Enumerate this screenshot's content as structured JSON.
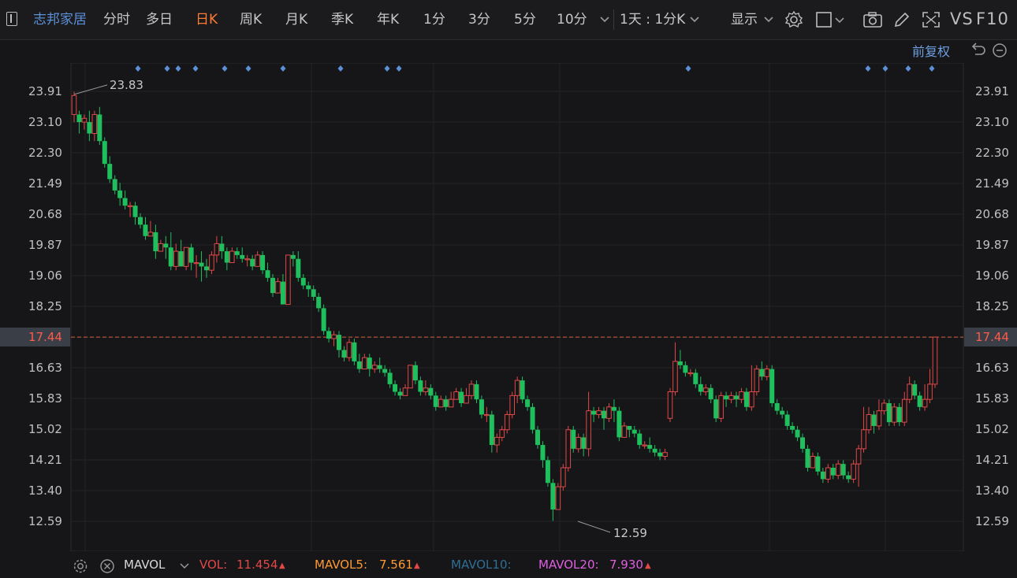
{
  "toolbar": {
    "stock_name": "志邦家居",
    "periods": [
      {
        "label": "分时",
        "active": false
      },
      {
        "label": "多日",
        "active": false
      },
      {
        "label": "日K",
        "active": true
      },
      {
        "label": "周K",
        "active": false
      },
      {
        "label": "月K",
        "active": false
      },
      {
        "label": "季K",
        "active": false
      },
      {
        "label": "年K",
        "active": false
      },
      {
        "label": "1分",
        "active": false
      },
      {
        "label": "3分",
        "active": false
      },
      {
        "label": "5分",
        "active": false
      },
      {
        "label": "10分",
        "active": false
      }
    ],
    "range_label": "1天 : 1分K",
    "display_label": "显示",
    "vs_label": "VS",
    "f10_label": "F10",
    "adjust_label": "前复权"
  },
  "chart_data": {
    "type": "candlestick",
    "y_ticks": [
      "23.91",
      "23.10",
      "22.30",
      "21.49",
      "20.68",
      "19.87",
      "19.06",
      "18.25",
      "17.44",
      "16.63",
      "15.83",
      "15.02",
      "14.21",
      "13.40",
      "12.59"
    ],
    "ylim": [
      12.59,
      23.91
    ],
    "current_price": "17.44",
    "high_label": "23.83",
    "low_label": "12.59",
    "candles": [
      [
        23.3,
        23.8,
        23.9,
        23.1
      ],
      [
        23.3,
        23.1,
        23.4,
        22.8
      ],
      [
        23.1,
        23.2,
        23.3,
        22.9
      ],
      [
        23.1,
        22.8,
        23.4,
        22.6
      ],
      [
        22.8,
        23.3,
        23.4,
        22.6
      ],
      [
        23.3,
        22.6,
        23.5,
        22.5
      ],
      [
        22.6,
        22.0,
        22.7,
        21.9
      ],
      [
        22.0,
        21.6,
        22.2,
        21.5
      ],
      [
        21.6,
        21.3,
        21.7,
        21.2
      ],
      [
        21.3,
        21.1,
        21.5,
        20.9
      ],
      [
        21.1,
        20.9,
        21.3,
        20.8
      ],
      [
        20.9,
        20.9,
        21.0,
        20.6
      ],
      [
        20.9,
        20.6,
        21.0,
        20.4
      ],
      [
        20.6,
        20.4,
        20.7,
        20.3
      ],
      [
        20.4,
        20.1,
        20.6,
        20.0
      ],
      [
        20.1,
        20.2,
        20.5,
        20.1
      ],
      [
        20.2,
        19.7,
        20.4,
        19.5
      ],
      [
        19.7,
        19.9,
        20.0,
        19.7
      ],
      [
        19.9,
        19.8,
        20.1,
        19.5
      ],
      [
        19.8,
        19.3,
        20.2,
        19.2
      ],
      [
        19.3,
        19.7,
        19.9,
        19.2
      ],
      [
        19.7,
        19.3,
        20.0,
        19.3
      ],
      [
        19.3,
        19.8,
        19.8,
        19.2
      ],
      [
        19.8,
        19.4,
        19.9,
        19.2
      ],
      [
        19.4,
        19.4,
        19.6,
        19.0
      ],
      [
        19.4,
        19.3,
        19.7,
        18.9
      ],
      [
        19.3,
        19.2,
        19.5,
        19.0
      ],
      [
        19.2,
        19.6,
        19.7,
        19.1
      ],
      [
        19.6,
        19.9,
        20.1,
        19.4
      ],
      [
        19.9,
        19.7,
        20.1,
        19.5
      ],
      [
        19.7,
        19.4,
        19.8,
        19.2
      ],
      [
        19.4,
        19.7,
        19.8,
        19.4
      ],
      [
        19.7,
        19.6,
        19.8,
        19.5
      ],
      [
        19.6,
        19.5,
        19.8,
        19.4
      ],
      [
        19.5,
        19.5,
        19.6,
        19.3
      ],
      [
        19.5,
        19.3,
        19.6,
        19.2
      ],
      [
        19.3,
        19.6,
        19.7,
        19.3
      ],
      [
        19.6,
        19.2,
        19.7,
        19.1
      ],
      [
        19.2,
        19.0,
        19.4,
        18.9
      ],
      [
        19.0,
        18.6,
        19.1,
        18.5
      ],
      [
        18.6,
        18.9,
        19.0,
        18.6
      ],
      [
        18.9,
        18.3,
        19.1,
        18.3
      ],
      [
        18.3,
        19.6,
        19.6,
        18.3
      ],
      [
        19.6,
        19.5,
        19.7,
        19.3
      ],
      [
        19.5,
        19.0,
        19.7,
        18.9
      ],
      [
        19.0,
        18.8,
        19.1,
        18.7
      ],
      [
        18.8,
        18.7,
        18.9,
        18.5
      ],
      [
        18.7,
        18.5,
        18.8,
        18.4
      ],
      [
        18.5,
        18.2,
        18.6,
        18.1
      ],
      [
        18.2,
        17.6,
        18.3,
        17.5
      ],
      [
        17.6,
        17.4,
        17.7,
        17.3
      ],
      [
        17.4,
        17.5,
        17.6,
        17.2
      ],
      [
        17.5,
        17.1,
        17.6,
        16.9
      ],
      [
        17.1,
        16.9,
        17.2,
        16.8
      ],
      [
        16.9,
        17.3,
        17.4,
        16.8
      ],
      [
        17.3,
        16.8,
        17.4,
        16.7
      ],
      [
        16.8,
        16.6,
        17.0,
        16.5
      ],
      [
        16.6,
        16.9,
        17.0,
        16.6
      ],
      [
        16.9,
        16.6,
        17.0,
        16.4
      ],
      [
        16.6,
        16.7,
        16.8,
        16.5
      ],
      [
        16.7,
        16.6,
        16.9,
        16.5
      ],
      [
        16.6,
        16.5,
        16.7,
        16.4
      ],
      [
        16.5,
        16.2,
        16.6,
        16.1
      ],
      [
        16.2,
        16.0,
        16.3,
        15.9
      ],
      [
        16.0,
        15.9,
        16.1,
        15.8
      ],
      [
        15.9,
        16.1,
        16.2,
        15.9
      ],
      [
        16.1,
        16.7,
        16.7,
        16.1
      ],
      [
        16.7,
        16.3,
        16.8,
        16.2
      ],
      [
        16.3,
        16.0,
        16.4,
        15.9
      ],
      [
        16.0,
        16.1,
        16.3,
        15.9
      ],
      [
        16.1,
        15.9,
        16.2,
        15.8
      ],
      [
        15.9,
        15.6,
        16.0,
        15.5
      ],
      [
        15.6,
        15.8,
        15.9,
        15.6
      ],
      [
        15.8,
        15.6,
        15.9,
        15.5
      ],
      [
        15.6,
        15.8,
        16.0,
        15.6
      ],
      [
        15.8,
        16.0,
        16.1,
        15.8
      ],
      [
        16.0,
        15.7,
        16.1,
        15.6
      ],
      [
        15.7,
        15.9,
        16.1,
        15.7
      ],
      [
        15.9,
        16.2,
        16.3,
        15.8
      ],
      [
        16.2,
        15.8,
        16.3,
        15.7
      ],
      [
        15.8,
        15.4,
        15.9,
        15.3
      ],
      [
        15.4,
        15.4,
        15.6,
        15.2
      ],
      [
        15.4,
        14.6,
        15.5,
        14.4
      ],
      [
        14.6,
        14.8,
        14.9,
        14.4
      ],
      [
        14.8,
        15.0,
        15.1,
        14.7
      ],
      [
        15.0,
        15.4,
        15.5,
        14.9
      ],
      [
        15.4,
        15.9,
        16.0,
        15.3
      ],
      [
        15.9,
        16.3,
        16.4,
        15.7
      ],
      [
        16.3,
        15.8,
        16.4,
        15.7
      ],
      [
        15.8,
        15.6,
        15.9,
        15.5
      ],
      [
        15.6,
        15.0,
        15.7,
        14.9
      ],
      [
        15.0,
        14.6,
        15.1,
        14.5
      ],
      [
        14.6,
        14.2,
        14.7,
        14.0
      ],
      [
        14.2,
        13.6,
        14.3,
        13.5
      ],
      [
        13.6,
        12.9,
        13.7,
        12.6
      ],
      [
        12.9,
        13.5,
        13.6,
        12.9
      ],
      [
        13.5,
        14.0,
        14.1,
        13.4
      ],
      [
        14.0,
        15.0,
        15.1,
        13.9
      ],
      [
        15.0,
        14.5,
        15.1,
        14.4
      ],
      [
        14.5,
        14.8,
        14.9,
        14.4
      ],
      [
        14.8,
        14.5,
        14.9,
        14.3
      ],
      [
        14.5,
        15.5,
        16.0,
        14.3
      ],
      [
        15.5,
        15.4,
        15.6,
        15.2
      ],
      [
        15.4,
        15.5,
        15.6,
        15.3
      ],
      [
        15.5,
        15.3,
        15.6,
        15.0
      ],
      [
        15.3,
        15.6,
        15.7,
        15.2
      ],
      [
        15.6,
        15.5,
        15.8,
        15.2
      ],
      [
        15.5,
        14.8,
        15.6,
        14.7
      ],
      [
        14.8,
        15.1,
        15.2,
        14.8
      ],
      [
        15.1,
        15.0,
        15.1,
        14.8
      ],
      [
        15.0,
        14.9,
        15.1,
        14.8
      ],
      [
        14.9,
        14.6,
        15.0,
        14.5
      ],
      [
        14.6,
        14.6,
        14.7,
        14.5
      ],
      [
        14.6,
        14.5,
        14.8,
        14.4
      ],
      [
        14.5,
        14.4,
        14.6,
        14.3
      ],
      [
        14.4,
        14.3,
        14.5,
        14.2
      ],
      [
        14.3,
        14.4,
        14.5,
        14.2
      ],
      [
        15.3,
        16.0,
        16.1,
        15.2
      ],
      [
        16.0,
        16.8,
        17.3,
        15.9
      ],
      [
        16.8,
        16.7,
        17.1,
        16.6
      ],
      [
        16.7,
        16.5,
        16.8,
        16.4
      ],
      [
        16.5,
        16.5,
        16.6,
        16.4
      ],
      [
        16.5,
        16.2,
        16.6,
        16.1
      ],
      [
        16.2,
        16.0,
        16.4,
        15.9
      ],
      [
        16.0,
        16.1,
        16.2,
        15.9
      ],
      [
        16.1,
        15.8,
        16.2,
        15.7
      ],
      [
        15.8,
        15.3,
        15.9,
        15.2
      ],
      [
        15.3,
        15.9,
        16.0,
        15.2
      ],
      [
        15.9,
        15.8,
        16.0,
        15.6
      ],
      [
        15.8,
        15.9,
        16.0,
        15.7
      ],
      [
        15.9,
        15.8,
        16.0,
        15.6
      ],
      [
        15.8,
        16.0,
        16.1,
        15.7
      ],
      [
        16.0,
        15.6,
        16.1,
        15.5
      ],
      [
        15.6,
        16.0,
        16.7,
        15.5
      ],
      [
        16.0,
        16.6,
        16.7,
        15.9
      ],
      [
        16.6,
        16.4,
        16.8,
        16.3
      ],
      [
        16.4,
        16.6,
        16.7,
        16.3
      ],
      [
        16.6,
        15.7,
        16.7,
        15.6
      ],
      [
        15.7,
        15.5,
        15.8,
        15.4
      ],
      [
        15.5,
        15.4,
        15.6,
        15.3
      ],
      [
        15.4,
        15.1,
        15.5,
        15.0
      ],
      [
        15.1,
        15.0,
        15.2,
        14.9
      ],
      [
        15.0,
        14.8,
        15.1,
        14.7
      ],
      [
        14.8,
        14.5,
        14.9,
        14.4
      ],
      [
        14.5,
        14.0,
        14.6,
        13.9
      ],
      [
        14.0,
        14.3,
        14.4,
        14.0
      ],
      [
        14.3,
        13.9,
        14.4,
        13.8
      ],
      [
        13.9,
        13.7,
        14.0,
        13.6
      ],
      [
        13.7,
        14.0,
        14.1,
        13.6
      ],
      [
        14.0,
        13.8,
        14.1,
        13.7
      ],
      [
        13.8,
        14.1,
        14.2,
        13.7
      ],
      [
        14.1,
        13.8,
        14.2,
        13.7
      ],
      [
        13.8,
        13.7,
        13.9,
        13.6
      ],
      [
        13.7,
        14.1,
        14.2,
        13.6
      ],
      [
        14.1,
        14.5,
        14.6,
        13.5
      ],
      [
        14.5,
        15.0,
        15.6,
        14.4
      ],
      [
        15.0,
        15.4,
        15.6,
        14.9
      ],
      [
        15.4,
        15.1,
        15.5,
        14.9
      ],
      [
        15.1,
        15.5,
        15.8,
        15.0
      ],
      [
        15.5,
        15.7,
        15.8,
        15.4
      ],
      [
        15.7,
        15.2,
        15.8,
        15.1
      ],
      [
        15.2,
        15.6,
        15.7,
        15.1
      ],
      [
        15.6,
        15.2,
        15.7,
        15.1
      ],
      [
        15.2,
        15.8,
        16.0,
        15.1
      ],
      [
        15.8,
        16.2,
        16.4,
        15.7
      ],
      [
        16.2,
        15.9,
        16.3,
        15.8
      ],
      [
        15.9,
        15.6,
        16.0,
        15.5
      ],
      [
        15.6,
        15.8,
        16.2,
        15.5
      ],
      [
        15.8,
        16.2,
        16.6,
        15.7
      ],
      [
        16.2,
        17.44,
        17.44,
        16.1
      ]
    ],
    "markers_count": 15
  },
  "volume": {
    "indicator_label": "MAVOL",
    "vol_label": "VOL:",
    "vol_value": "11.454",
    "mavol5_label": "MAVOL5:",
    "mavol5_value": "7.561",
    "mavol10_label": "MAVOL10:",
    "mavol20_label": "MAVOL20:",
    "mavol20_value": "7.930"
  },
  "colors": {
    "up": "#e14848",
    "down": "#1fbf5e",
    "active_period": "#ff7a33",
    "accent_blue": "#5b8fd6",
    "mavol5": "#ff9a33",
    "mavol20": "#e05fe0",
    "mavol10": "#2f6f96"
  }
}
